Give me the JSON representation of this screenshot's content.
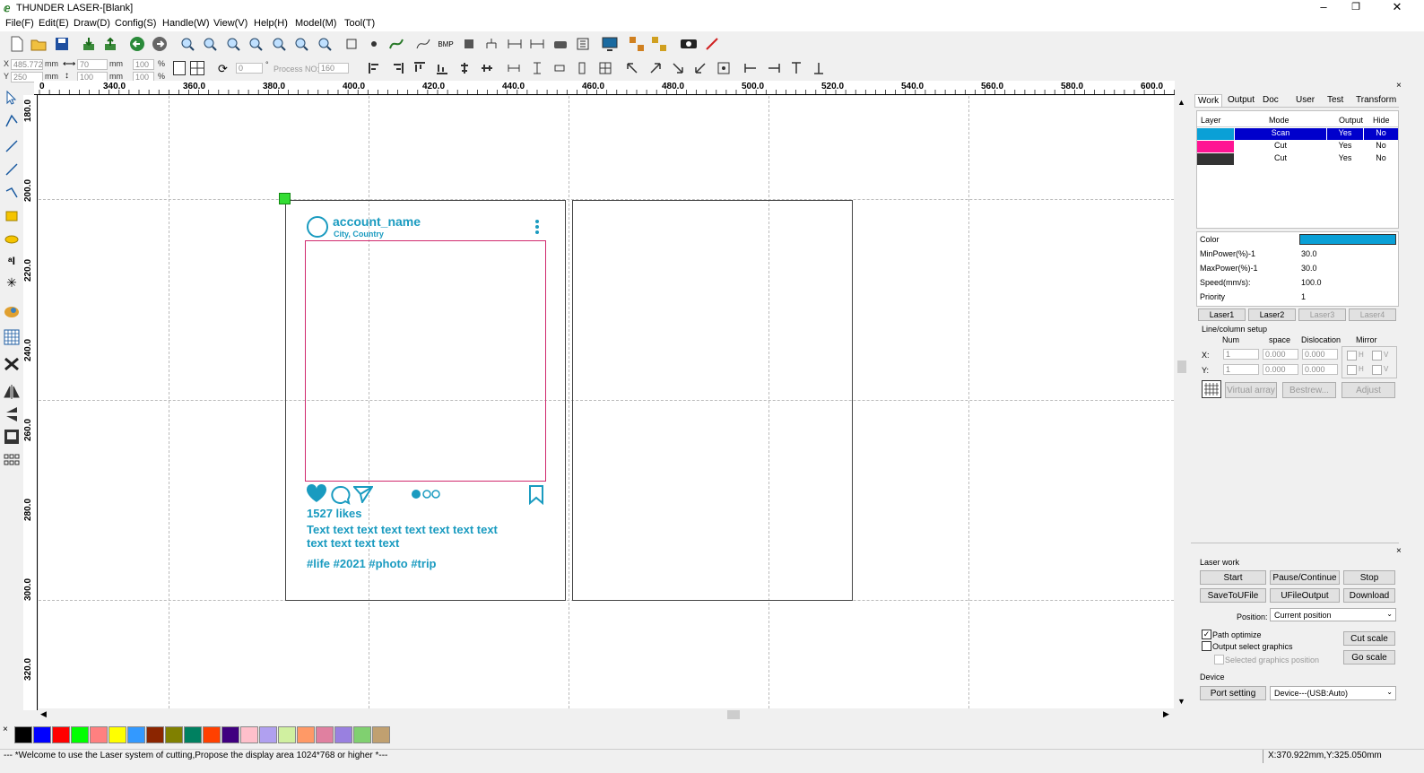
{
  "window": {
    "title": "THUNDER LASER-[Blank]",
    "controls": [
      "–",
      "❐",
      "✕"
    ]
  },
  "menu": [
    "File(F)",
    "Edit(E)",
    "Draw(D)",
    "Config(S)",
    "Handle(W)",
    "View(V)",
    "Help(H)",
    "Model(M)",
    "Tool(T)"
  ],
  "coords": {
    "x_label": "X",
    "y_label": "Y",
    "x_value": "485.772",
    "y_value": "250",
    "unit": "mm",
    "w_value": "70",
    "h_value": "100",
    "w_pct": "100",
    "h_pct": "100",
    "pct": "%",
    "rotate": "0",
    "deg": "°",
    "process_label": "Process NO:",
    "process_no": "160"
  },
  "ruler": {
    "h_labels": [
      "0",
      "340.0",
      "360.0",
      "380.0",
      "400.0",
      "420.0",
      "440.0",
      "460.0",
      "480.0",
      "500.0",
      "520.0",
      "540.0",
      "560.0",
      "580.0",
      "600.0"
    ],
    "v_labels": [
      "180.0",
      "200.0",
      "220.0",
      "240.0",
      "260.0",
      "280.0",
      "300.0",
      "320.0"
    ]
  },
  "design": {
    "account_name": "account_name",
    "location": "City, Country",
    "likes": "1527 likes",
    "caption_line1": "Text text text text text text text text",
    "caption_line2": "text text text text",
    "hashtags": "#life #2021 #photo #trip",
    "accent_color": "#1a9bc0",
    "cut_color": "#d02a6e"
  },
  "palette": [
    "#000000",
    "#0000ff",
    "#ff0000",
    "#00ff00",
    "#ff8080",
    "#ffff00",
    "#3399ff",
    "#8b2500",
    "#808000",
    "#008060",
    "#ff4000",
    "#400080",
    "#ffc0cb",
    "#b0a0f0",
    "#d0f0a0",
    "#ff9966",
    "#e080a0",
    "#9980e0",
    "#80d070",
    "#c0a070"
  ],
  "status": {
    "message": "--- *Welcome to use the Laser system of cutting,Propose the display area 1024*768 or higher *---",
    "position": "X:370.922mm,Y:325.050mm"
  },
  "panel": {
    "tabs": [
      "Work",
      "Output",
      "Doc",
      "User",
      "Test",
      "Transform"
    ],
    "layer_headers": [
      "Layer",
      "Mode",
      "Output",
      "Hide"
    ],
    "layers": [
      {
        "color": "#0aa0d6",
        "mode": "Scan",
        "output": "Yes",
        "hide": "No",
        "selected": true
      },
      {
        "color": "#ff1493",
        "mode": "Cut",
        "output": "Yes",
        "hide": "No",
        "selected": false
      },
      {
        "color": "#333333",
        "mode": "Cut",
        "output": "Yes",
        "hide": "No",
        "selected": false
      }
    ],
    "props": {
      "color_label": "Color",
      "color_value": "#0aa0d6",
      "min_label": "MinPower(%)-1",
      "min_value": "30.0",
      "max_label": "MaxPower(%)-1",
      "max_value": "30.0",
      "speed_label": "Speed(mm/s):",
      "speed_value": "100.0",
      "priority_label": "Priority",
      "priority_value": "1"
    },
    "laser_tabs": [
      "Laser1",
      "Laser2",
      "Laser3",
      "Laser4"
    ],
    "array": {
      "title": "Line/column setup",
      "num": "Num",
      "space": "space",
      "dislocation": "Dislocation",
      "mirror": "Mirror",
      "x_label": "X:",
      "y_label": "Y:",
      "x_num": "1",
      "x_space": "0.000",
      "x_disl": "0.000",
      "y_num": "1",
      "y_space": "0.000",
      "y_disl": "0.000",
      "h": "H",
      "v": "V",
      "virtual_array": "Virtual array",
      "bestrew": "Bestrew...",
      "adjust": "Adjust"
    },
    "laser_work": {
      "title": "Laser work",
      "start": "Start",
      "pause": "Pause/Continue",
      "stop": "Stop",
      "save_ufile": "SaveToUFile",
      "ufile_output": "UFileOutput",
      "download": "Download",
      "position_label": "Position:",
      "position_value": "Current position",
      "path_optimize": "Path optimize",
      "output_select": "Output select graphics",
      "selected_pos": "Selected graphics position",
      "cut_scale": "Cut scale",
      "go_scale": "Go scale",
      "device_title": "Device",
      "port_setting": "Port setting",
      "device_value": "Device---(USB:Auto)"
    }
  }
}
